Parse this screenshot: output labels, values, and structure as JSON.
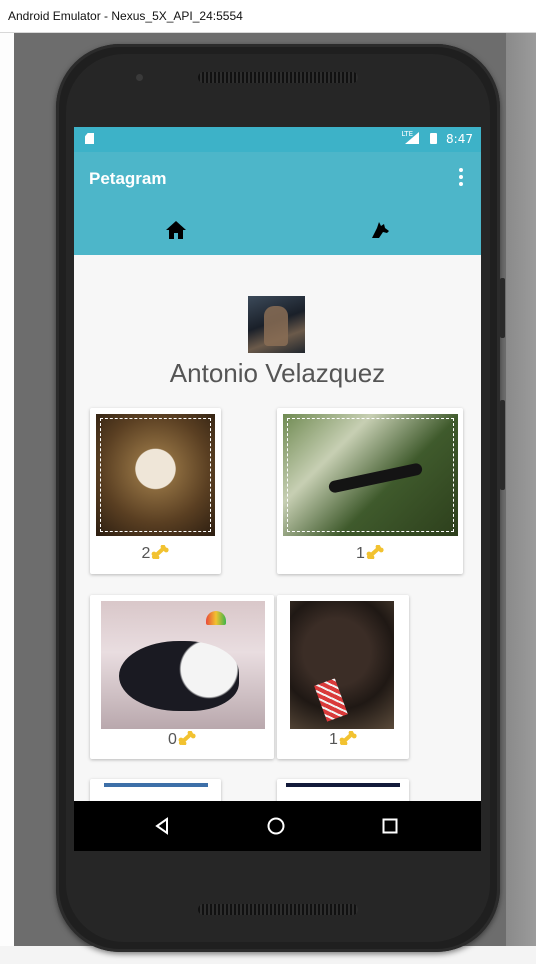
{
  "window": {
    "title": "Android Emulator - Nexus_5X_API_24:5554"
  },
  "status_bar": {
    "time": "8:47",
    "network": "LTE"
  },
  "toolbar": {
    "title": "Petagram",
    "menu_icon": "overflow-menu-icon"
  },
  "tabs": [
    {
      "icon": "home-icon",
      "selected": true
    },
    {
      "icon": "dog-icon",
      "selected": false
    }
  ],
  "profile": {
    "name": "Antonio Velazquez"
  },
  "pets": [
    {
      "likes": "2",
      "photo": "bulldog-photo"
    },
    {
      "likes": "1",
      "photo": "caterpillar-photo"
    },
    {
      "likes": "0",
      "photo": "guinea-pig-photo"
    },
    {
      "likes": "1",
      "photo": "poodle-photo"
    }
  ],
  "like_icon": "bone-icon",
  "colors": {
    "accent": "#4db6c9",
    "status_bar": "#3db2c8",
    "bone": "#f2c230"
  },
  "nav_bar": [
    {
      "icon": "back-icon"
    },
    {
      "icon": "home-circle-icon"
    },
    {
      "icon": "recents-icon"
    }
  ]
}
